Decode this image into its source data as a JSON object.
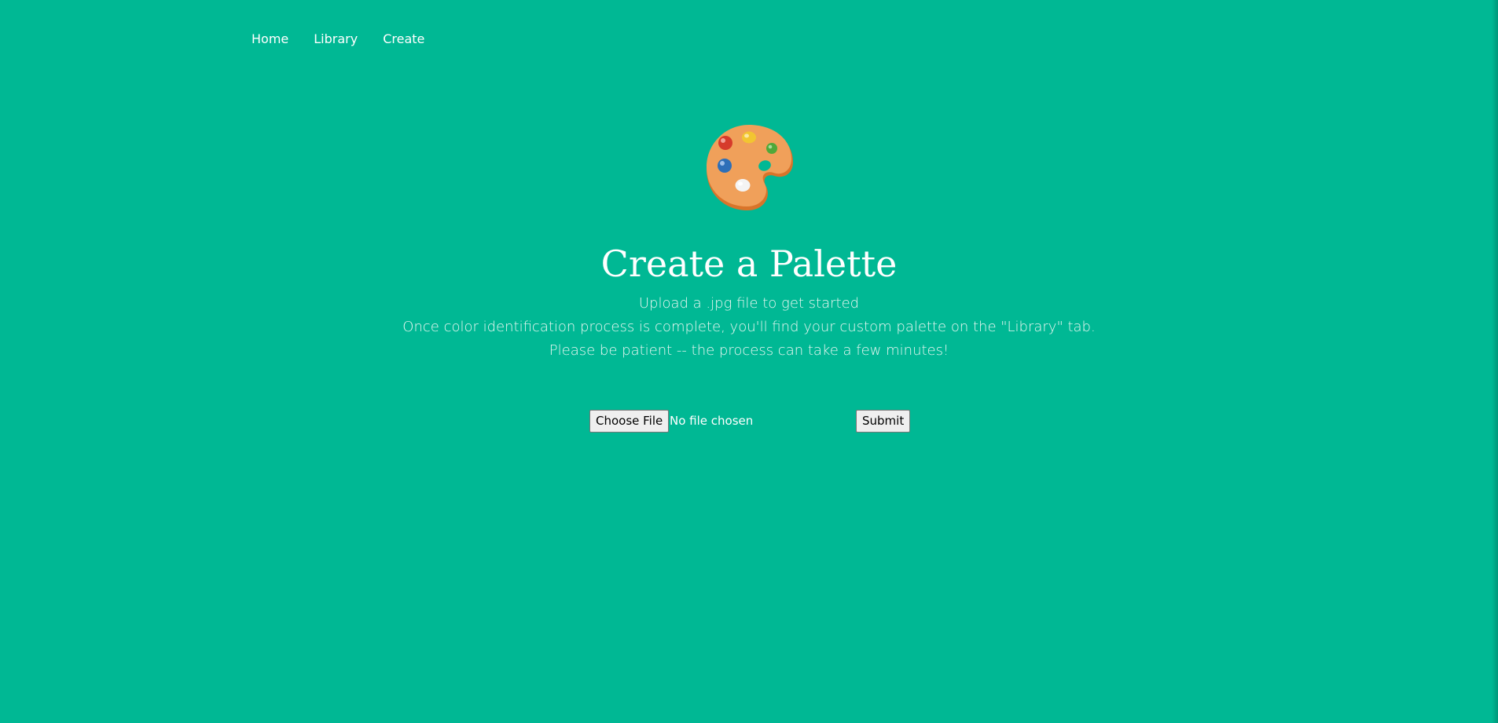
{
  "nav": {
    "items": [
      {
        "label": "Home"
      },
      {
        "label": "Library"
      },
      {
        "label": "Create"
      }
    ]
  },
  "hero": {
    "icon": "artist-palette-icon",
    "title": "Create a Palette",
    "lines": [
      "Upload a .jpg file to get started",
      "Once color identification process is complete, you'll find your custom palette on the \"Library\" tab.",
      "Please be patient -- the process can take a few minutes!"
    ]
  },
  "form": {
    "choose_file_label": "Choose File",
    "file_status": "No file chosen",
    "submit_label": "Submit"
  },
  "colors": {
    "background": "#00b894",
    "text": "#ffffff",
    "palette_body": "#f0a05a",
    "palette_edge": "#d9742a"
  }
}
